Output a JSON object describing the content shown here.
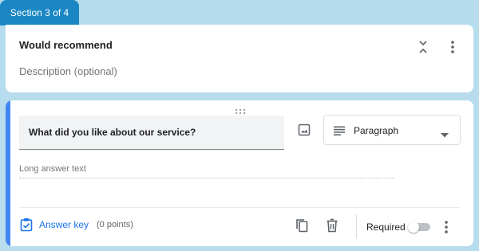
{
  "section": {
    "tab_label": "Section 3 of 4",
    "title": "Would recommend",
    "description_placeholder": "Description (optional)"
  },
  "question": {
    "title": "What did you like about our service?",
    "type_label": "Paragraph",
    "answer_placeholder": "Long answer text",
    "answer_key_label": "Answer key",
    "points_label": "(0 points)",
    "required_label": "Required",
    "required": false
  },
  "icons": {
    "collapse": "collapse-icon",
    "more": "more-vert-icon",
    "drag": "drag-handle-icon",
    "image": "image-icon",
    "paragraph": "paragraph-icon",
    "dropdown": "dropdown-arrow-icon",
    "answer_key": "answer-key-icon",
    "duplicate": "duplicate-icon",
    "delete": "delete-icon"
  },
  "colors": {
    "background": "#b7dcee",
    "section_tab": "#1a87c4",
    "accent": "#4285f4",
    "link": "#1a73e8"
  }
}
